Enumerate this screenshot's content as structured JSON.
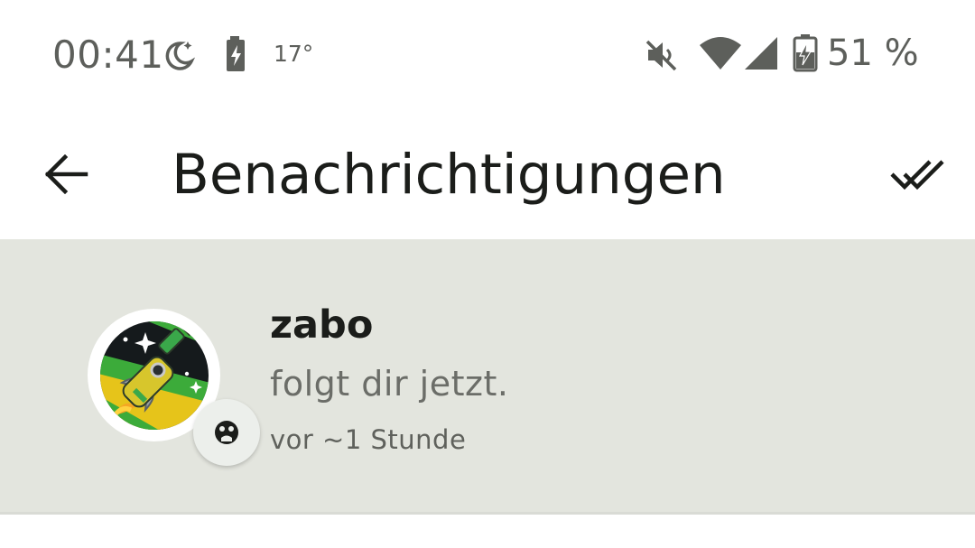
{
  "status_bar": {
    "time": "00:41",
    "temperature": "17°",
    "battery_percent": "51 %",
    "icons": [
      "do-not-disturb-moon-icon",
      "charging-battery-icon",
      "muted-speaker-icon",
      "wifi-icon",
      "cell-signal-icon",
      "battery-charging-icon"
    ]
  },
  "header": {
    "title": "Benachrichtigungen",
    "back_icon": "arrow-back-icon",
    "mark_read_icon": "double-check-icon"
  },
  "notifications": [
    {
      "user": "zabo",
      "action": "folgt dir jetzt.",
      "time": "vor ~1 Stunde",
      "avatar": "rocket-bottle-avatar",
      "badge_icon": "follow-face-icon",
      "background": "#e3e5de"
    }
  ]
}
